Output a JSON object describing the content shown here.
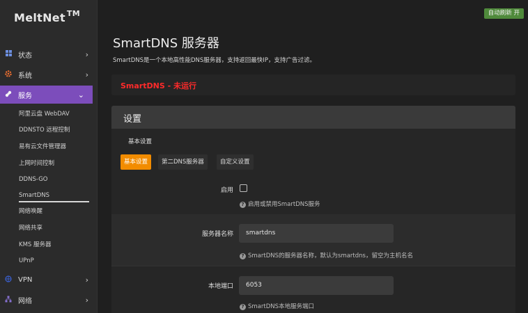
{
  "brand": {
    "name": "MeltNet",
    "mark": "TM"
  },
  "sidebar": {
    "items": [
      {
        "label": "状态",
        "icon": "dashboard-icon"
      },
      {
        "label": "系统",
        "icon": "gear-icon"
      },
      {
        "label": "服务",
        "icon": "services-icon"
      },
      {
        "label": "VPN",
        "icon": "vpn-icon"
      },
      {
        "label": "网络",
        "icon": "network-icon"
      }
    ],
    "sub_items": [
      "阿里云盘 WebDAV",
      "DDNSTO 远程控制",
      "易有云文件管理器",
      "上网时间控制",
      "DDNS-GO",
      "SmartDNS",
      "网络唤醒",
      "网络共享",
      "KMS 服务器",
      "UPnP"
    ],
    "selected_sub": "SmartDNS"
  },
  "header": {
    "auto_refresh": "自动刷新 开"
  },
  "page": {
    "title": "SmartDNS 服务器",
    "description": "SmartDNS是一个本地高性能DNS服务器，支持返回最快IP，支持广告过滤。",
    "status": "SmartDNS - 未运行"
  },
  "settings": {
    "title": "设置",
    "section": "基本设置",
    "tabs": [
      "基本设置",
      "第二DNS服务器",
      "自定义设置"
    ],
    "active_tab": "基本设置",
    "enable": {
      "label": "启用",
      "checked": false,
      "hint": "启用或禁用SmartDNS服务"
    },
    "server_name": {
      "label": "服务器名称",
      "value": "smartdns",
      "hint": "SmartDNS的服务器名称，默认为smartdns，留空为主机名名"
    },
    "local_port": {
      "label": "本地端口",
      "value": "6053",
      "hint": "SmartDNS本地服务端口"
    }
  },
  "colors": {
    "accent_purple": "#7c4dbb",
    "tab_orange": "#f28c00",
    "status_red": "#ff2a2a",
    "refresh_green": "#4f8a3b"
  }
}
